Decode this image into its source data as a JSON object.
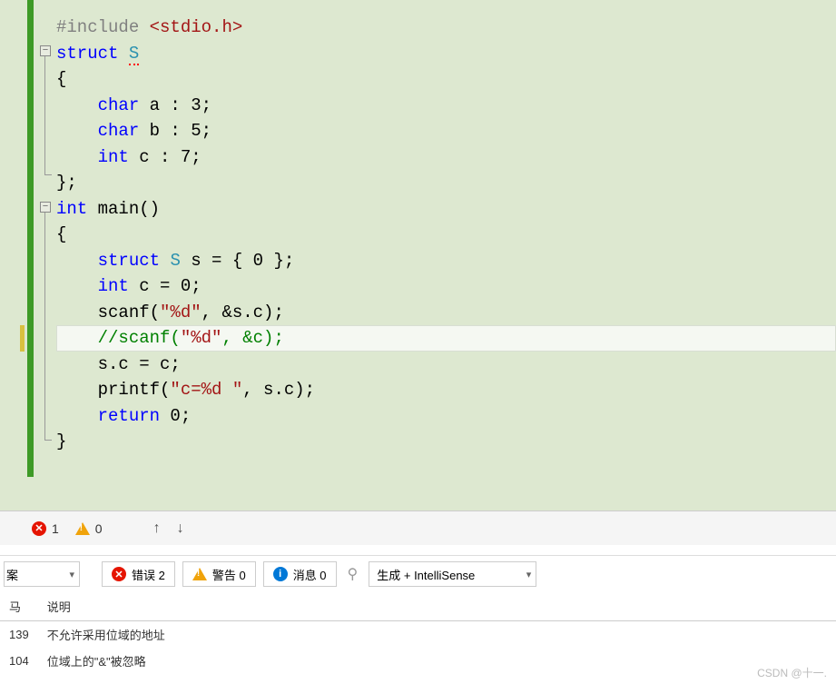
{
  "code": {
    "lines": [
      {
        "type": "preproc",
        "tokens": [
          {
            "t": "#include ",
            "c": "pp"
          },
          {
            "t": "<stdio.h>",
            "c": "inc"
          }
        ]
      },
      {
        "type": "line",
        "tokens": [
          {
            "t": "struct",
            "c": "kw"
          },
          {
            "t": " ",
            "c": ""
          },
          {
            "t": "S",
            "c": "type err-underline"
          }
        ]
      },
      {
        "type": "line",
        "tokens": [
          {
            "t": "{",
            "c": "punc"
          }
        ]
      },
      {
        "type": "line",
        "tokens": [
          {
            "t": "    ",
            "c": ""
          },
          {
            "t": "char",
            "c": "kw"
          },
          {
            "t": " a : 3;",
            "c": "punc"
          }
        ]
      },
      {
        "type": "line",
        "tokens": [
          {
            "t": "    ",
            "c": ""
          },
          {
            "t": "char",
            "c": "kw"
          },
          {
            "t": " b : 5;",
            "c": "punc"
          }
        ]
      },
      {
        "type": "line",
        "tokens": [
          {
            "t": "    ",
            "c": ""
          },
          {
            "t": "int",
            "c": "kw"
          },
          {
            "t": " c : 7;",
            "c": "punc"
          }
        ]
      },
      {
        "type": "line",
        "tokens": [
          {
            "t": "};",
            "c": "punc"
          }
        ]
      },
      {
        "type": "line",
        "tokens": [
          {
            "t": "int",
            "c": "kw"
          },
          {
            "t": " main()",
            "c": "punc"
          }
        ]
      },
      {
        "type": "line",
        "tokens": [
          {
            "t": "{",
            "c": "punc"
          }
        ]
      },
      {
        "type": "line",
        "tokens": [
          {
            "t": "    ",
            "c": ""
          },
          {
            "t": "struct",
            "c": "kw"
          },
          {
            "t": " ",
            "c": ""
          },
          {
            "t": "S",
            "c": "type"
          },
          {
            "t": " s = { 0 };",
            "c": "punc"
          }
        ]
      },
      {
        "type": "line",
        "tokens": [
          {
            "t": "    ",
            "c": ""
          },
          {
            "t": "int",
            "c": "kw"
          },
          {
            "t": " c = 0;",
            "c": "punc"
          }
        ]
      },
      {
        "type": "line",
        "tokens": [
          {
            "t": "    scanf(",
            "c": "punc"
          },
          {
            "t": "\"%d\"",
            "c": "str"
          },
          {
            "t": ", &s.c);",
            "c": "punc"
          }
        ]
      },
      {
        "type": "current",
        "tokens": [
          {
            "t": "    ",
            "c": ""
          },
          {
            "t": "//scanf(",
            "c": "comment"
          },
          {
            "t": "\"%d\"",
            "c": "str"
          },
          {
            "t": ", &c);",
            "c": "comment"
          }
        ]
      },
      {
        "type": "line",
        "tokens": [
          {
            "t": "    s.c = c;",
            "c": "punc"
          }
        ]
      },
      {
        "type": "line",
        "tokens": [
          {
            "t": "    printf(",
            "c": "punc"
          },
          {
            "t": "\"c=%d \"",
            "c": "str"
          },
          {
            "t": ", s.c);",
            "c": "punc"
          }
        ]
      },
      {
        "type": "line",
        "tokens": [
          {
            "t": "    ",
            "c": ""
          },
          {
            "t": "return",
            "c": "kw"
          },
          {
            "t": " 0;",
            "c": "punc"
          }
        ]
      },
      {
        "type": "line",
        "tokens": [
          {
            "t": "}",
            "c": "punc"
          }
        ]
      }
    ]
  },
  "statusbar": {
    "error_count": "1",
    "warning_count": "0"
  },
  "toolbar": {
    "scope_suffix": "案",
    "errors_label": "错误 2",
    "warnings_label": "警告 0",
    "messages_label": "消息 0",
    "build_label": "生成 + IntelliSense"
  },
  "table": {
    "col_code": "马",
    "col_desc": "说明",
    "rows": [
      {
        "code": "139",
        "desc": "不允许采用位域的地址"
      },
      {
        "code": "104",
        "desc": "位域上的\"&\"被忽略"
      }
    ]
  },
  "watermark": "CSDN @十一."
}
